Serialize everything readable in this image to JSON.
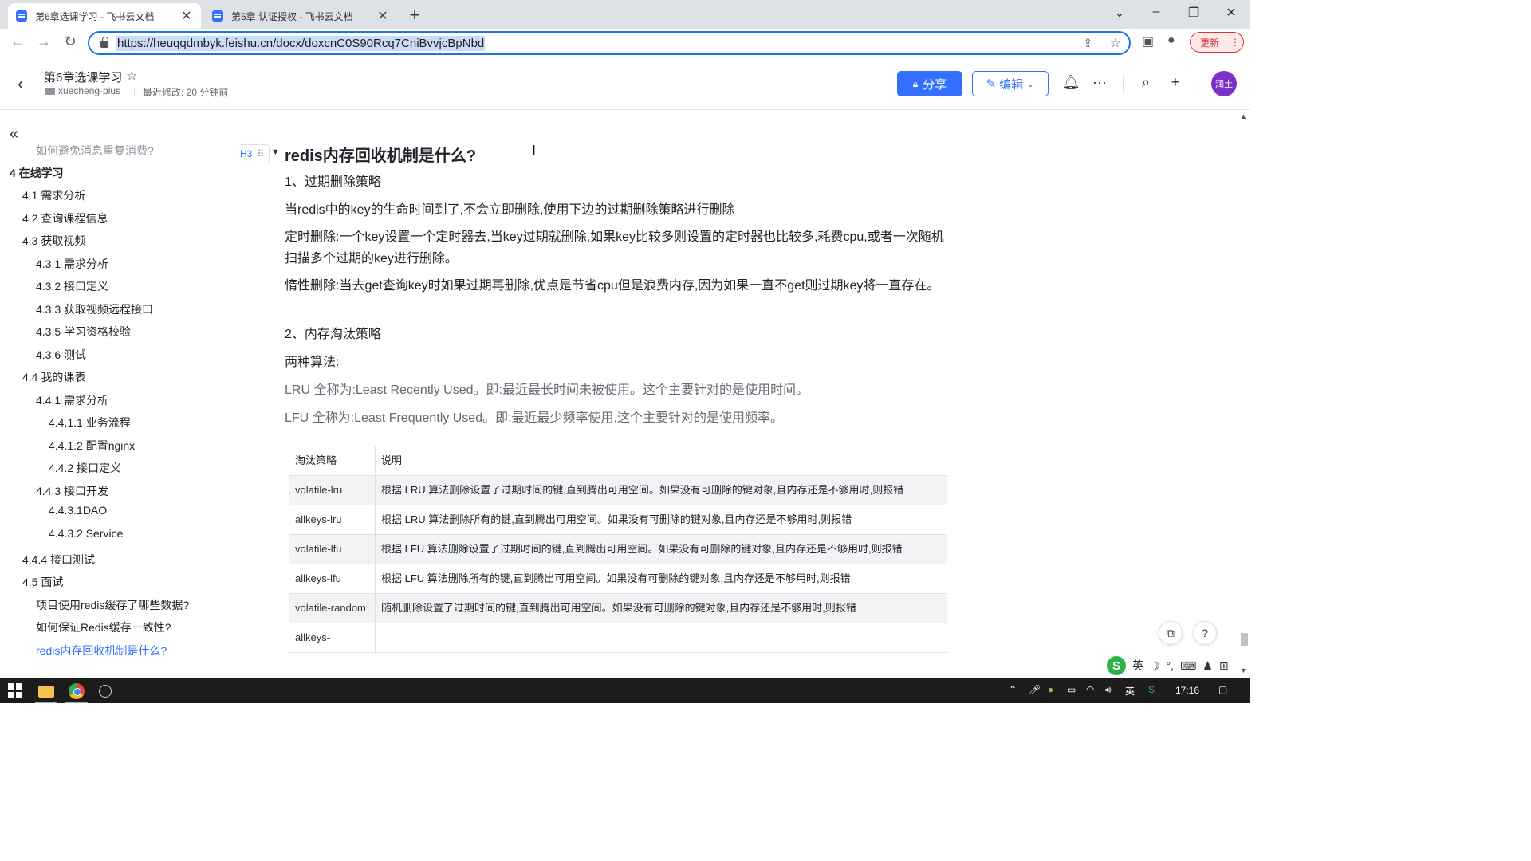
{
  "browser": {
    "tabs": [
      {
        "title": "第6章选课学习 - 飞书云文档",
        "active": true
      },
      {
        "title": "第5章 认证授权 - 飞书云文档",
        "active": false
      }
    ],
    "url": "https://heuqqdmbyk.feishu.cn/docx/doxcnC0S90Rcq7CniBvvjcBpNbd",
    "update_label": "更新"
  },
  "doc_header": {
    "title": "第6章选课学习",
    "folder": "xuecheng-plus",
    "last_modified": "最近修改: 20 分钟前",
    "share_label": "分享",
    "edit_label": "编辑",
    "avatar_text": "润土"
  },
  "outline": {
    "items": [
      {
        "label": "如何避免消息重复消费?",
        "level": 3
      },
      {
        "label": "4 在线学习",
        "level": 0
      },
      {
        "label": "4.1 需求分析",
        "level": 1
      },
      {
        "label": "4.2 查询课程信息",
        "level": 1
      },
      {
        "label": "4.3 获取视频",
        "level": 1
      },
      {
        "label": "4.3.1 需求分析",
        "level": 2
      },
      {
        "label": "4.3.2 接口定义",
        "level": 2
      },
      {
        "label": "4.3.3 获取视频远程接口",
        "level": 2
      },
      {
        "label": "4.3.5 学习资格校验",
        "level": 2
      },
      {
        "label": "4.3.6 测试",
        "level": 2
      },
      {
        "label": "4.4 我的课表",
        "level": 1
      },
      {
        "label": "4.4.1 需求分析",
        "level": 2
      },
      {
        "label": "4.4.1.1 业务流程",
        "level": 3
      },
      {
        "label": "4.4.1.2 配置nginx",
        "level": 3
      },
      {
        "label": "4.4.2 接口定义",
        "level": 3
      },
      {
        "label": "4.4.3 接口开发",
        "level": 2
      },
      {
        "label": "4.4.3.1DAO",
        "level": 3
      },
      {
        "label": "4.4.3.2 Service",
        "level": 3
      },
      {
        "label": "4.4.4 接口测试",
        "level": 1
      },
      {
        "label": "4.5 面试",
        "level": 1
      },
      {
        "label": "项目使用redis缓存了哪些数据?",
        "level": 2
      },
      {
        "label": "如何保证Redis缓存一致性?",
        "level": 2
      },
      {
        "label": "redis内存回收机制是什么?",
        "level": 2
      }
    ]
  },
  "content": {
    "heading_badge": "H3",
    "heading": "redis内存回收机制是什么?",
    "paragraphs": [
      "1、过期删除策略",
      "当redis中的key的生命时间到了,不会立即删除,使用下边的过期删除策略进行删除",
      "定时删除:一个key设置一个定时器去,当key过期就删除,如果key比较多则设置的定时器也比较多,耗费cpu,或者一次随机扫描多个过期的key进行删除。",
      "惰性删除:当去get查询key时如果过期再删除,优点是节省cpu但是浪费内存,因为如果一直不get则过期key将一直存在。",
      "2、内存淘汰策略",
      "两种算法:",
      "LRU 全称为:Least Recently Used。即:最近最长时间未被使用。这个主要针对的是使用时间。",
      "LFU 全称为:Least Frequently Used。即:最近最少频率使用,这个主要针对的是使用频率。"
    ],
    "table": {
      "headers": [
        "淘汰策略",
        "说明"
      ],
      "rows": [
        [
          "volatile-lru",
          "根据 LRU 算法删除设置了过期时间的键,直到腾出可用空间。如果没有可删除的键对象,且内存还是不够用时,则报错"
        ],
        [
          "allkeys-lru",
          "根据 LRU 算法删除所有的键,直到腾出可用空间。如果没有可删除的键对象,且内存还是不够用时,则报错"
        ],
        [
          "volatile-lfu",
          "根据 LFU 算法删除设置了过期时间的键,直到腾出可用空间。如果没有可删除的键对象,且内存还是不够用时,则报错"
        ],
        [
          "allkeys-lfu",
          "根据 LFU 算法删除所有的键,直到腾出可用空间。如果没有可删除的键对象,且内存还是不够用时,则报错"
        ],
        [
          "volatile-random",
          "随机删除设置了过期时间的键,直到腾出可用空间。如果没有可删除的键对象,且内存还是不够用时,则报错"
        ],
        [
          "allkeys-",
          ""
        ]
      ]
    }
  },
  "ime": {
    "lang": "英"
  },
  "taskbar": {
    "lang": "英",
    "time": "17:16"
  }
}
